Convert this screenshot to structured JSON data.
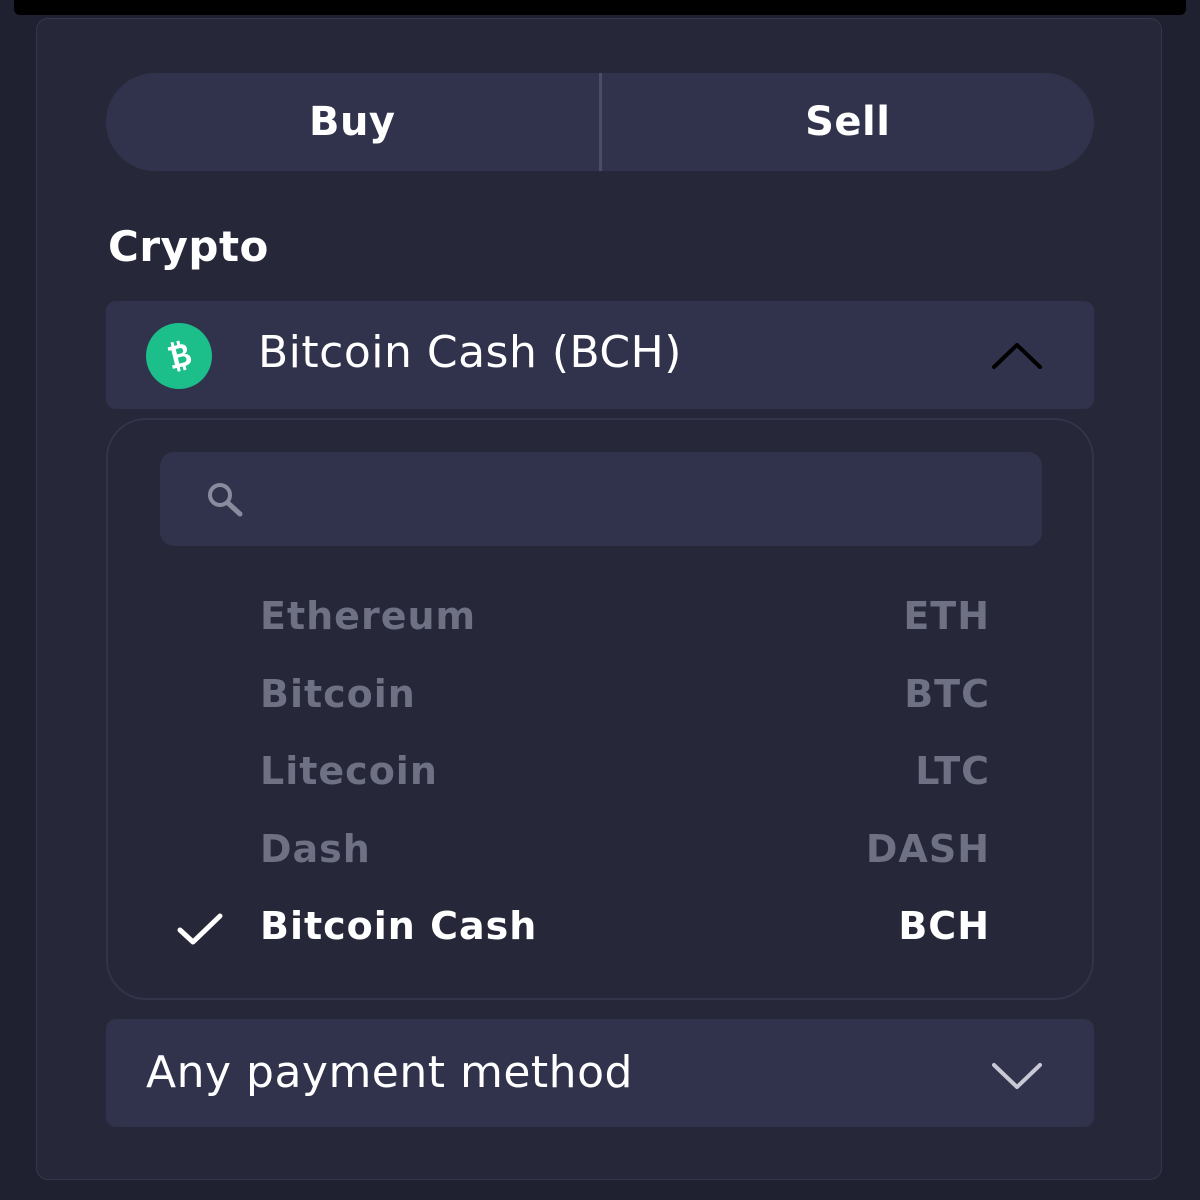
{
  "trade_toggle": {
    "buy_label": "Buy",
    "sell_label": "Sell"
  },
  "crypto_section": {
    "label": "Crypto",
    "selected": {
      "name": "Bitcoin Cash (BCH)",
      "icon": "bitcoin-cash-logo",
      "icon_color": "#1cbf8a"
    },
    "expanded_icon": "chevron-up-icon"
  },
  "dropdown": {
    "search": {
      "icon": "search-icon",
      "value": "",
      "placeholder": ""
    },
    "options": [
      {
        "name": "Ethereum",
        "code": "ETH",
        "selected": false
      },
      {
        "name": "Bitcoin",
        "code": "BTC",
        "selected": false
      },
      {
        "name": "Litecoin",
        "code": "LTC",
        "selected": false
      },
      {
        "name": "Dash",
        "code": "DASH",
        "selected": false
      },
      {
        "name": "Bitcoin Cash",
        "code": "BCH",
        "selected": true
      }
    ]
  },
  "payment": {
    "value": "Any payment method",
    "icon": "chevron-down-icon"
  },
  "colors": {
    "background": "#1f2131",
    "panel": "#262839",
    "control": "#31334d",
    "muted_text": "#6e7083",
    "accent_green": "#1cbf8a"
  }
}
